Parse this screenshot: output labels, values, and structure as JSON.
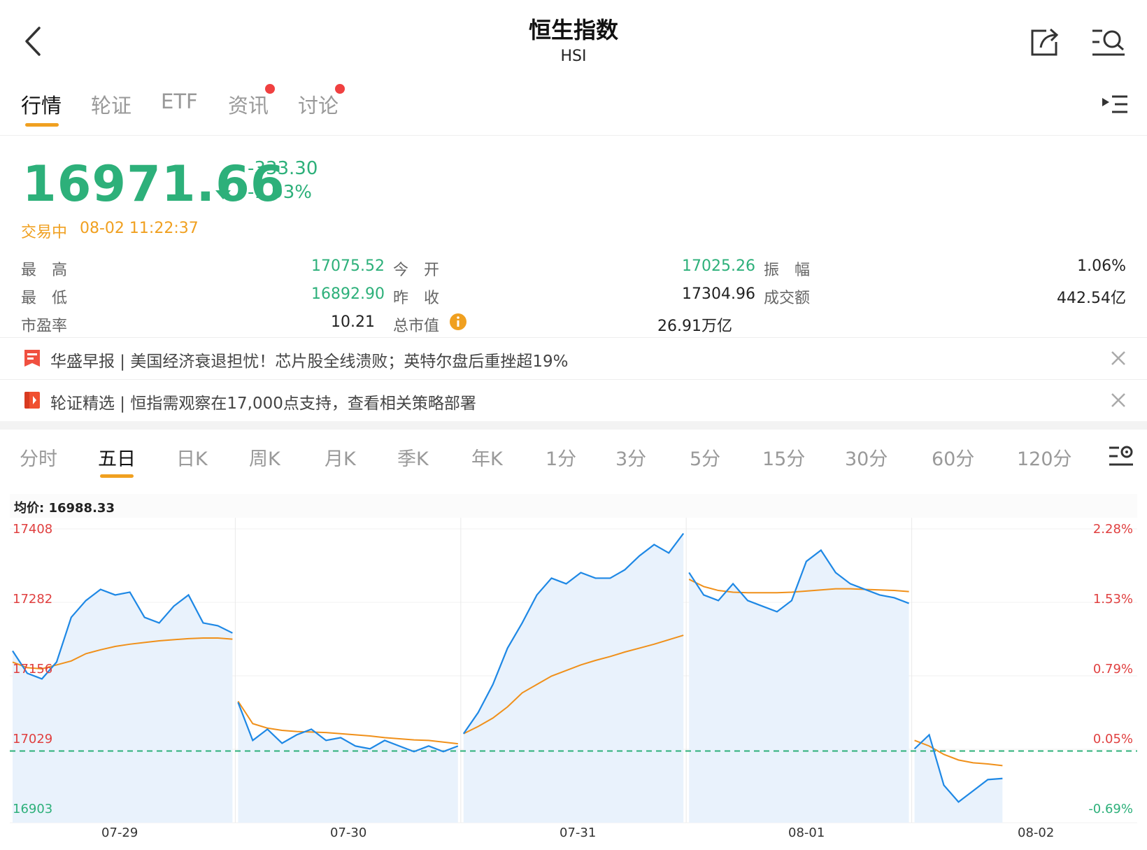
{
  "header": {
    "title": "恒生指数",
    "subtitle": "HSI"
  },
  "tabs": [
    {
      "label": "行情",
      "active": true
    },
    {
      "label": "轮证"
    },
    {
      "label": "ETF"
    },
    {
      "label": "资讯",
      "dot": true
    },
    {
      "label": "讨论",
      "dot": true
    }
  ],
  "quote": {
    "price": "16971.66",
    "change": "-333.30",
    "change_pct": "-1.93%",
    "status": "交易中",
    "time": "08-02 11:22:37"
  },
  "stats": {
    "high_label": "最　高",
    "high": "17075.52",
    "low_label": "最　低",
    "low": "16892.90",
    "pe_label": "市盈率",
    "pe": "10.21",
    "open_label": "今　开",
    "open": "17025.26",
    "prev_label": "昨　收",
    "prev": "17304.96",
    "mcap_label": "总市值",
    "mcap": "26.91万亿",
    "amp_label": "振　幅",
    "amp": "1.06%",
    "turnover_label": "成交额",
    "turnover": "442.54亿"
  },
  "news": [
    {
      "text": "华盛早报 | 美国经济衰退担忧！芯片股全线溃败；英特尔盘后重挫超19%"
    },
    {
      "text": "轮证精选 | 恒指需观察在17,000点支持，查看相关策略部署"
    }
  ],
  "periods": [
    "分时",
    "五日",
    "日K",
    "周K",
    "月K",
    "季K",
    "年K",
    "1分",
    "3分",
    "5分",
    "15分",
    "30分",
    "60分",
    "120分"
  ],
  "active_period": "五日",
  "chart_data": {
    "type": "line",
    "avg_label": "均价: 16988.33",
    "y_ticks_left": [
      "17408",
      "17282",
      "17156",
      "17029",
      "16903"
    ],
    "y_ticks_right": [
      "2.28%",
      "1.53%",
      "0.79%",
      "0.05%",
      "-0.69%"
    ],
    "ylim": [
      16903,
      17408
    ],
    "prev_close": 17021,
    "x_labels": [
      "07-29",
      "07-30",
      "07-31",
      "08-01",
      "08-02"
    ],
    "series": [
      {
        "color": "#1e88e5",
        "days": [
          [
            17200,
            17160,
            17150,
            17180,
            17260,
            17290,
            17310,
            17300,
            17305,
            17260,
            17250,
            17280,
            17300,
            17250,
            17245,
            17232
          ],
          [
            17108,
            17040,
            17060,
            17035,
            17050,
            17060,
            17040,
            17045,
            17030,
            17025,
            17040,
            17030,
            17020,
            17030,
            17020,
            17030
          ],
          [
            17052,
            17090,
            17140,
            17205,
            17250,
            17300,
            17330,
            17320,
            17340,
            17330,
            17330,
            17345,
            17370,
            17390,
            17375,
            17410
          ],
          [
            17340,
            17300,
            17290,
            17320,
            17290,
            17280,
            17270,
            17290,
            17360,
            17380,
            17340,
            17320,
            17310,
            17300,
            17295,
            17285
          ],
          [
            17025,
            17050,
            16960,
            16930,
            16950,
            16970,
            16972
          ]
        ]
      },
      {
        "color": "#f0901a",
        "days": [
          [
            17180,
            17170,
            17168,
            17175,
            17182,
            17195,
            17202,
            17208,
            17212,
            17215,
            17218,
            17220,
            17222,
            17223,
            17223,
            17221
          ],
          [
            17110,
            17070,
            17062,
            17058,
            17056,
            17055,
            17054,
            17052,
            17050,
            17048,
            17045,
            17043,
            17041,
            17040,
            17037,
            17034
          ],
          [
            17052,
            17065,
            17080,
            17100,
            17125,
            17140,
            17155,
            17165,
            17175,
            17183,
            17190,
            17198,
            17205,
            17212,
            17220,
            17228
          ],
          [
            17328,
            17315,
            17308,
            17305,
            17304,
            17304,
            17304,
            17305,
            17307,
            17309,
            17311,
            17311,
            17310,
            17309,
            17308,
            17306
          ],
          [
            17040,
            17030,
            17015,
            17005,
            17000,
            16998,
            16995
          ]
        ]
      }
    ]
  }
}
